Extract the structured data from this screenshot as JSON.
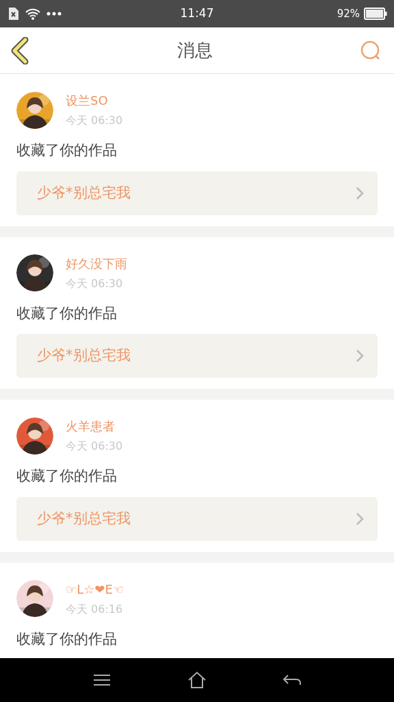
{
  "status_bar": {
    "time": "11:47",
    "battery_text": "92%"
  },
  "header": {
    "title": "消息"
  },
  "messages": [
    {
      "name": "设兰SO",
      "time": "今天 06:30",
      "text": "收藏了你的作品",
      "work": "少爷*别总宅我"
    },
    {
      "name": "好久没下雨",
      "time": "今天 06:30",
      "text": "收藏了你的作品",
      "work": "少爷*别总宅我"
    },
    {
      "name": "火羊患者",
      "time": "今天 06:30",
      "text": "收藏了你的作品",
      "work": "少爷*别总宅我"
    },
    {
      "name": "☞L☆❤E☜",
      "time": "今天 06:16",
      "text": "收藏了你的作品"
    }
  ]
}
